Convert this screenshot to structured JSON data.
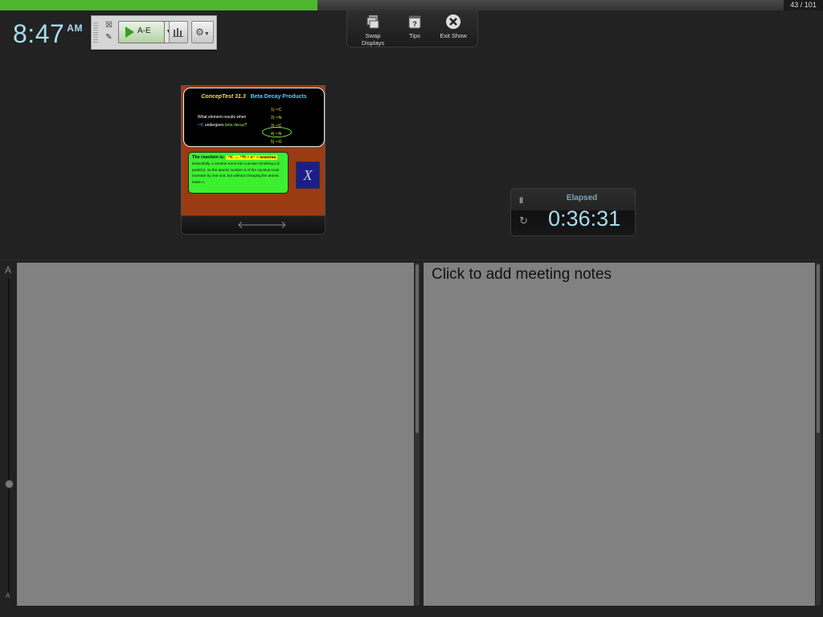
{
  "progress": {
    "slide_counter": "43 / 101",
    "fraction": 0.405,
    "fill_color": "#4fb52c"
  },
  "clock": {
    "time": "8:47",
    "ampm": "AM"
  },
  "toolbar": {
    "start_label": "A-E",
    "icons": {
      "close": "close-icon",
      "edit": "edit-icon",
      "dropdown": "chevron-down-icon",
      "chart": "bar-chart-icon",
      "settings": "gear-icon"
    }
  },
  "presenter_tools": {
    "swap_displays": "Swap Displays",
    "tips": "Tips",
    "exit_show": "Exit Show"
  },
  "slide": {
    "title_a": "ConcepTest 31.3",
    "title_b": "Beta Decay Products",
    "question_line1": "What element results when",
    "question_line2_pre": "¹⁴C",
    "question_line2_mid": " undergoes ",
    "question_line2_hl": "beta decay",
    "question_line2_end": "?",
    "options": [
      "1) ¹⁵C",
      "2) ¹⁵N",
      "3) ¹⁴C",
      "4) ¹⁴N",
      "5) ¹⁵O"
    ],
    "answer_prefix": "The reaction is:",
    "answer_equation": "¹⁴C → ¹⁴N + e⁻ + neutrino",
    "answer_body": "Essentially, a neutron turns into a proton (emitting a β⁻ particle), so the atomic number Z of the nucleus must increase by one unit, but without changing the atomic mass A.",
    "symbol": "X"
  },
  "slide_nav": {
    "prev": "🡐",
    "next": "🡒"
  },
  "timer": {
    "label": "Elapsed",
    "value": "0:36:31",
    "pause": "II",
    "reset": "↻"
  },
  "zoom": {
    "top": "A",
    "bottom": "A"
  },
  "notes": {
    "placeholder": "Click to add meeting notes"
  }
}
